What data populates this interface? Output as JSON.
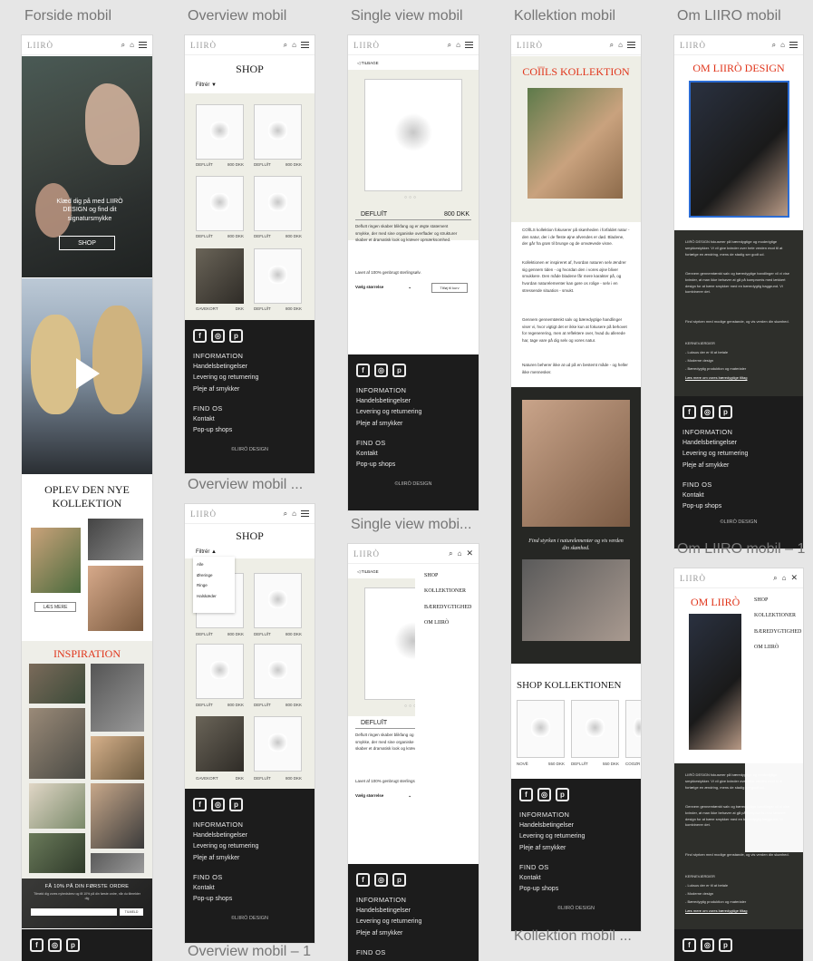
{
  "labels": {
    "c1": "Forside mobil",
    "c2": "Overview mobil",
    "c3": "Single view mobil",
    "c4": "Kollektion mobil",
    "c5": "Om LIIRO mobil",
    "c2b": "Overview mobil ...",
    "c2c": "Overview mobil – 1",
    "c3b": "Single view mobi...",
    "c4b": "Kollektion mobil ...",
    "c5b": "Om LIIRO mobil – 1"
  },
  "brand": {
    "logo": "LIIRÒ"
  },
  "footer": {
    "fb": "f",
    "ig": "◎",
    "pin": "p",
    "info": "INFORMATION",
    "l1": "Handelsbetingelser",
    "l2": "Levering og returnering",
    "l3": "Pleje af smykker",
    "find": "FIND OS",
    "l4": "Kontakt",
    "l5": "Pop-up shops",
    "copy": "©LIIRÒ DESIGN"
  },
  "forside": {
    "hero_text": "Klæd dig på med LIIRÒ DESIGN og find dit signatursmykke",
    "shop_btn": "SHOP",
    "oplev": "OPLEV DEN NYE KOLLEKTION",
    "laes": "LÆS MERE",
    "inspiration": "INSPIRATION",
    "news_title": "FÅ 10% PÅ DIN FØRSTE ORDRE",
    "news_body": "Tilmeld dig vores nyhedsbrev og få 10% på din første ordre, når du tilmelder dig",
    "news_btn": "TILMELD"
  },
  "overview": {
    "title": "SHOP",
    "filter": "Filtrér ▼",
    "filter_open": "Filtrér ▲",
    "filter_opts": [
      "Alle",
      "Øreringe",
      "Ringe",
      "Halskæder"
    ],
    "products": [
      {
        "name": "DEFLUÏT",
        "price": "800 DKK"
      },
      {
        "name": "DEFLUÏT",
        "price": "800 DKK"
      },
      {
        "name": "DEFLUÏT",
        "price": "800 DKK"
      },
      {
        "name": "DEFLUÏT",
        "price": "800 DKK"
      },
      {
        "name": "GAVEKORT",
        "price": "DKK"
      },
      {
        "name": "DEFLUÏT",
        "price": "800 DKK"
      }
    ]
  },
  "single": {
    "back": "◁ TILBAGE",
    "name": "DEFLUÏT",
    "price": "800 DKK",
    "desc": "Defluït ringen skaber blikfang og er ægte statement smykke, der med sine organiske overflader og strukturer skaber et dramatisk look og kræver opmærksomhed.",
    "material": "Lavet af 100% genbrugt sterlingsølv.",
    "size": "Vælg størrelse",
    "cart": "Tilføj til kurv",
    "menu": [
      "SHOP",
      "KOLLEKTIONER",
      "BÆREDYGTIGHED",
      "OM LIIRÒ"
    ]
  },
  "kollektion": {
    "title": "COÏÏLS KOLLEKTION",
    "p1": "COÏÏLS kollektion fokuserer på skønheden i forfaldet natur - den natur, der i de fleste øjne afvendes er død. Bladene, der går fra grøn til brunge og de omvævede visne.",
    "p2": "Kollektionen er inspireret af, hvordan naturen selv ændrer sig gennem tiden - og hvordan den i vores øjne bliver smukkere. Den måde bladene får mere karakter på, og hvordan naturelementer kan gøre os rolige - selv i en stressende situation - smukt.",
    "p3": "Gennem gennemtænkt salv og bæredygtige handlinger viser vi, hvor vigtigt det er ikke kun at fokusere på behovet for regenerering, men at reflektere over, hvad du allerede har, tage vare på dig selv og vores natur.",
    "p4": "Naturen beherer ikke at ud på en bestemt måde - og heller ikke mennesker.",
    "quote": "Find styrken i naturelementer og vis verden din skønhed.",
    "shop": "SHOP KOLLEKTIONEN",
    "items": [
      {
        "name": "NOVË",
        "price": "550 DKK"
      },
      {
        "name": "DEFLUÏT",
        "price": "550 DKK"
      },
      {
        "name": "COOZR",
        "price": ""
      }
    ]
  },
  "om": {
    "title": "OM LIIRÒ DESIGN",
    "title_short": "OM LIIRÒ",
    "p1": "LIIRÒ DESIGN fokuserer på bæredygtige og moderigtige smykkestykker. Vi vil give kvinder over hele verden mod til at fortælge en ændring, mens de stadig ser godt ud.",
    "p2": "Gennem gennemtænkt salv og bæredygtige handlinger vil vi vise kvinder, at man ikke behøver at gå på kompromis med lækkert design for at bære smykker med en bæredygtig baggrund. Vi kombinerer det.",
    "p3": "Find styrken med modige genstande, og vis verden din skønhed.",
    "values_h": "KERNEVÆRDIER",
    "v1": "- Luksus der er til at betale",
    "v2": "- Moderne design",
    "v3": "- Bæredygtig produktion og materialer",
    "link": "Læs mere om vores bæredygtige tiltag",
    "menu": [
      "SHOP",
      "KOLLEKTIONER",
      "BÆREDYGTIGHED",
      "OM LIIRÒ"
    ]
  }
}
